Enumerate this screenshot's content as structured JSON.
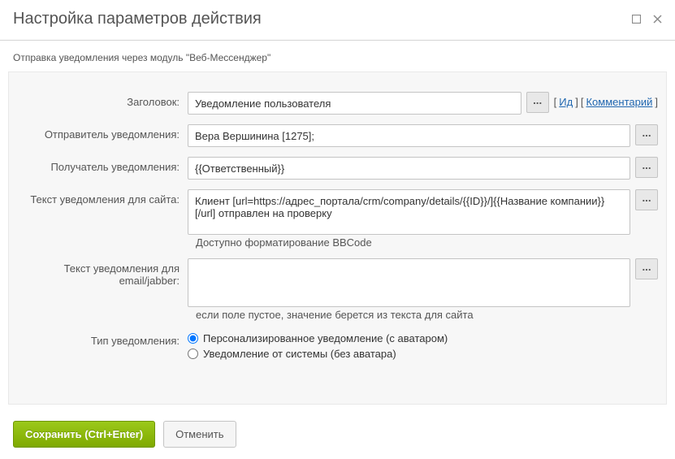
{
  "window": {
    "title": "Настройка параметров действия"
  },
  "subheader": "Отправка уведомления через модуль \"Веб-Мессенджер\"",
  "form": {
    "title_label": "Заголовок:",
    "title_value": "Уведомление пользователя",
    "link_id": "Ид",
    "link_comment": "Комментарий",
    "sender_label": "Отправитель уведомления:",
    "sender_value": "Вера Вершинина [1275];",
    "recipient_label": "Получатель уведомления:",
    "recipient_value": "{{Ответственный}}",
    "site_text_label": "Текст уведомления для сайта:",
    "site_text_value": "Клиент [url=https://адрес_портала/crm/company/details/{{ID}}/]{{Название компании}}[/url] отправлен на проверку",
    "site_text_note": "Доступно форматирование BBCode",
    "email_text_label": "Текст уведомления для email/jabber:",
    "email_text_value": "",
    "email_text_note": "если поле пустое, значение берется из текста для сайта",
    "type_label": "Тип уведомления:",
    "type_option1": "Персонализированное уведомление (с аватаром)",
    "type_option2": "Уведомление от системы (без аватара)"
  },
  "footer": {
    "save": "Сохранить (Ctrl+Enter)",
    "cancel": "Отменить"
  },
  "ellipsis": "..."
}
